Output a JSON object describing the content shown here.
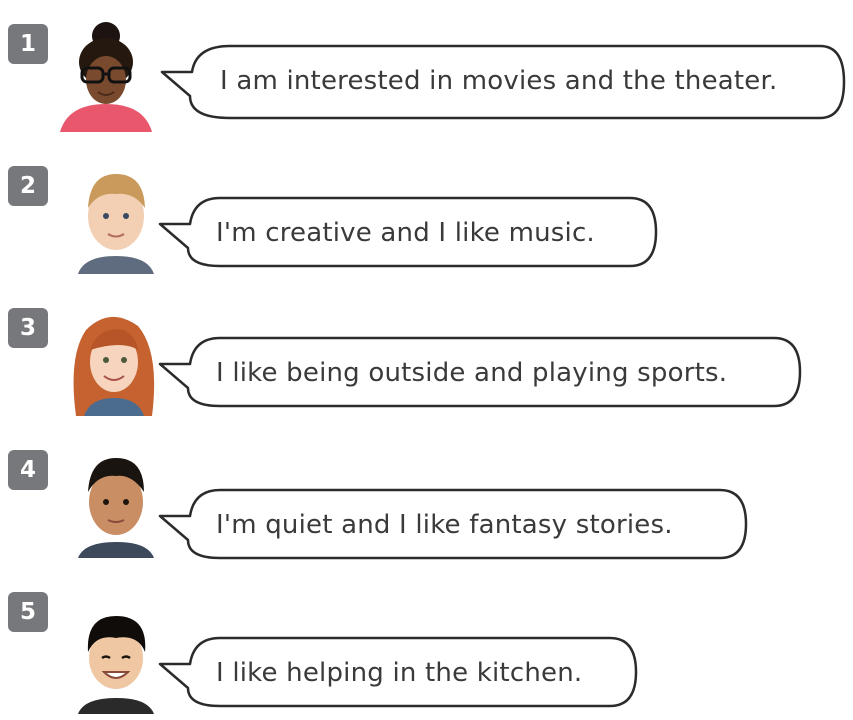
{
  "items": [
    {
      "number": "1",
      "text": "I am interested in movies and the theater.",
      "portrait": "girl-with-glasses-portrait"
    },
    {
      "number": "2",
      "text": "I'm creative and I like music.",
      "portrait": "blond-boy-portrait"
    },
    {
      "number": "3",
      "text": "I like being outside and playing sports.",
      "portrait": "red-haired-girl-portrait"
    },
    {
      "number": "4",
      "text": "I'm quiet and I like fantasy stories.",
      "portrait": "dark-haired-boy-portrait"
    },
    {
      "number": "5",
      "text": "I like helping in the kitchen.",
      "portrait": "smiling-boy-portrait"
    }
  ],
  "colors": {
    "badge": "#77787b",
    "bubble_stroke": "#2b2b2b",
    "text": "#3a3a3a"
  }
}
